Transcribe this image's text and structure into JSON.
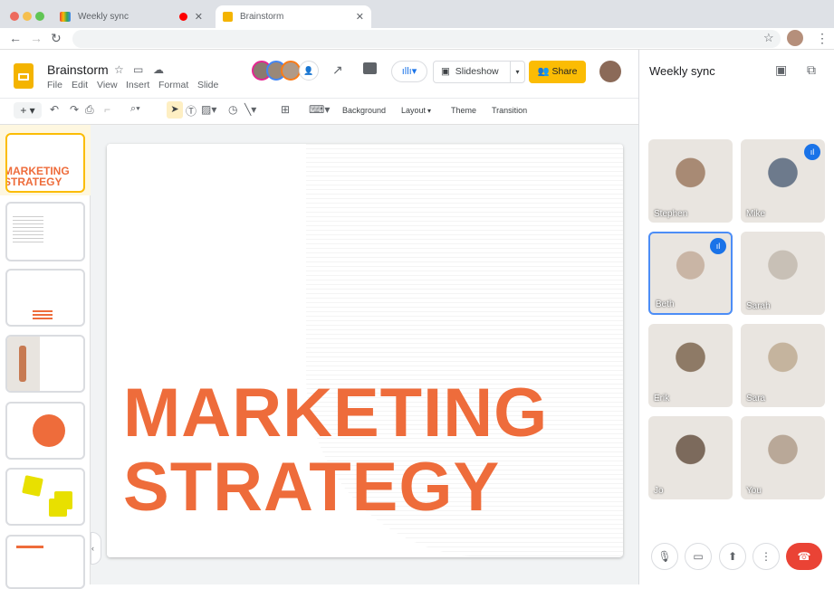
{
  "browser": {
    "tabs": [
      {
        "label": "Weekly sync",
        "recording": true
      },
      {
        "label": "Brainstorm",
        "active": true
      }
    ]
  },
  "docs": {
    "title": "Brainstorm",
    "menus": [
      "File",
      "Edit",
      "View",
      "Insert",
      "Format",
      "Slide"
    ],
    "slideshow_label": "Slideshow",
    "share_label": "Share",
    "toolbar": {
      "background": "Background",
      "layout": "Layout",
      "theme": "Theme",
      "transition": "Transition"
    },
    "slide": {
      "line1": "MARKETING",
      "line2": "STRATEGY"
    },
    "thumbs": {
      "t1a": "MARKETING",
      "t1b": "STRATEGY"
    }
  },
  "meet": {
    "title": "Weekly sync",
    "participants": [
      {
        "name": "Stephen",
        "speaking": false,
        "color": "#a88a74"
      },
      {
        "name": "Mike",
        "speaking": true,
        "color": "#6d7a8c"
      },
      {
        "name": "Beth",
        "speaking": true,
        "color": "#c9b5a5"
      },
      {
        "name": "Sarah",
        "speaking": false,
        "color": "#c8c0b6"
      },
      {
        "name": "Erik",
        "speaking": false,
        "color": "#8e7a66"
      },
      {
        "name": "Sara",
        "speaking": false,
        "color": "#c5b49e"
      },
      {
        "name": "Jo",
        "speaking": false,
        "color": "#7c6a5c"
      },
      {
        "name": "You",
        "speaking": false,
        "color": "#b9a898"
      }
    ]
  },
  "colors": {
    "accent": "#ee6c3b",
    "share": "#fbbc04",
    "end_call": "#ea4335",
    "speaking": "#1a73e8"
  }
}
